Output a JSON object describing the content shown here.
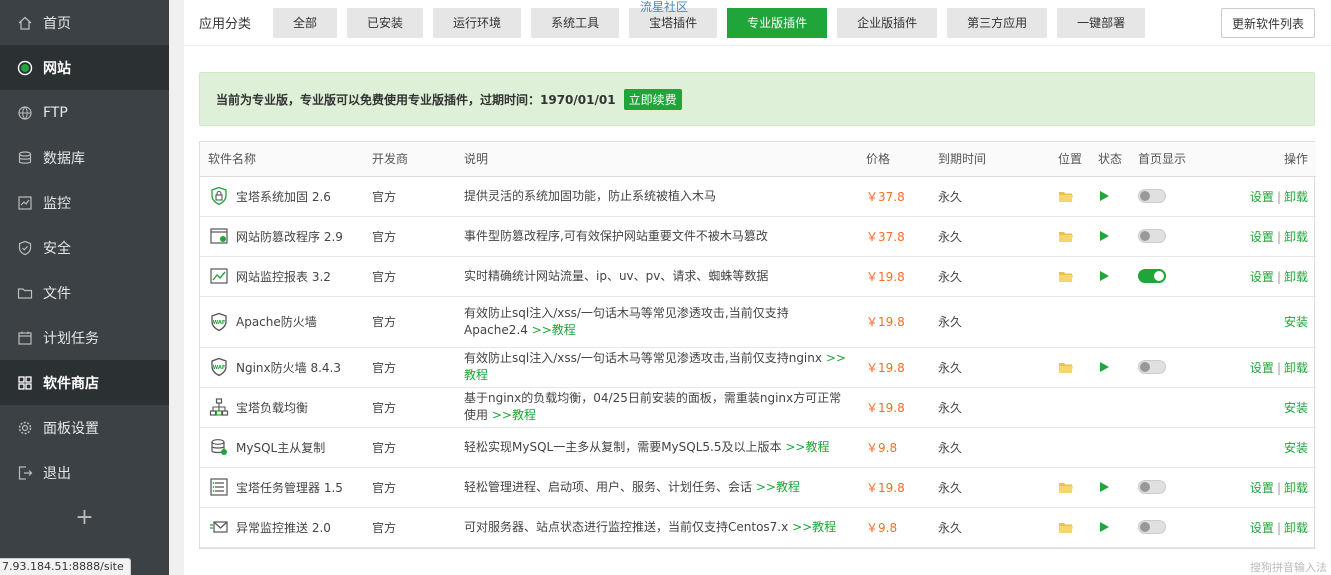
{
  "sidebar": {
    "items": [
      {
        "label": "首页",
        "icon": "home-icon",
        "active": false
      },
      {
        "label": "网站",
        "icon": "globe-icon",
        "active": true
      },
      {
        "label": "FTP",
        "icon": "ftp-icon",
        "active": false
      },
      {
        "label": "数据库",
        "icon": "database-icon",
        "active": false
      },
      {
        "label": "监控",
        "icon": "monitor-icon",
        "active": false
      },
      {
        "label": "安全",
        "icon": "shield-icon",
        "active": false
      },
      {
        "label": "文件",
        "icon": "folder-icon",
        "active": false
      },
      {
        "label": "计划任务",
        "icon": "calendar-icon",
        "active": false
      },
      {
        "label": "软件商店",
        "icon": "grid-icon",
        "active": true
      },
      {
        "label": "面板设置",
        "icon": "gear-icon",
        "active": false
      },
      {
        "label": "退出",
        "icon": "logout-icon",
        "active": false
      }
    ],
    "add_label": "+"
  },
  "status_url": "7.93.184.51:8888/site",
  "watermark": "流星社区",
  "categories": {
    "label": "应用分类",
    "items": [
      "全部",
      "已安装",
      "运行环境",
      "系统工具",
      "宝塔插件",
      "专业版插件",
      "企业版插件",
      "第三方应用",
      "一键部署"
    ],
    "active_index": 5,
    "refresh_label": "更新软件列表"
  },
  "notice": {
    "text": "当前为专业版，专业版可以免费使用专业版插件，过期时间：1970/01/01",
    "renew_label": "立即续费"
  },
  "table": {
    "headers": [
      "软件名称",
      "开发商",
      "说明",
      "价格",
      "到期时间",
      "位置",
      "状态",
      "首页显示",
      "操作"
    ],
    "rows": [
      {
        "name": "宝塔系统加固 2.6",
        "icon": "lock-shield-icon",
        "dev": "官方",
        "desc": "提供灵活的系统加固功能，防止系统被植入木马",
        "tutorial": "",
        "price": "￥37.8",
        "expire": "永久",
        "installed": true,
        "home_on": false,
        "ops": [
          "设置",
          "卸载"
        ]
      },
      {
        "name": "网站防篡改程序 2.9",
        "icon": "browser-lock-icon",
        "dev": "官方",
        "desc": "事件型防篡改程序,可有效保护网站重要文件不被木马篡改",
        "tutorial": "",
        "price": "￥37.8",
        "expire": "永久",
        "installed": true,
        "home_on": false,
        "ops": [
          "设置",
          "卸载"
        ]
      },
      {
        "name": "网站监控报表 3.2",
        "icon": "chart-icon",
        "dev": "官方",
        "desc": "实时精确统计网站流量、ip、uv、pv、请求、蜘蛛等数据",
        "tutorial": "",
        "price": "￥19.8",
        "expire": "永久",
        "installed": true,
        "home_on": true,
        "ops": [
          "设置",
          "卸载"
        ]
      },
      {
        "name": "Apache防火墙",
        "icon": "waf-icon",
        "dev": "官方",
        "desc": "有效防止sql注入/xss/一句话木马等常见渗透攻击,当前仅支持Apache2.4",
        "tutorial": ">>教程",
        "price": "￥19.8",
        "expire": "永久",
        "installed": false,
        "home_on": false,
        "ops": [
          "安装"
        ]
      },
      {
        "name": "Nginx防火墙 8.4.3",
        "icon": "waf-icon",
        "dev": "官方",
        "desc": "有效防止sql注入/xss/一句话木马等常见渗透攻击,当前仅支持nginx",
        "tutorial": ">>教程",
        "price": "￥19.8",
        "expire": "永久",
        "installed": true,
        "home_on": false,
        "ops": [
          "设置",
          "卸载"
        ]
      },
      {
        "name": "宝塔负载均衡",
        "icon": "network-icon",
        "dev": "官方",
        "desc": "基于nginx的负载均衡，04/25日前安装的面板，需重装nginx方可正常使用",
        "tutorial": ">>教程",
        "price": "￥19.8",
        "expire": "永久",
        "installed": false,
        "home_on": false,
        "ops": [
          "安装"
        ]
      },
      {
        "name": "MySQL主从复制",
        "icon": "db-sync-icon",
        "dev": "官方",
        "desc": "轻松实现MySQL一主多从复制，需要MySQL5.5及以上版本",
        "tutorial": ">>教程",
        "price": "￥9.8",
        "expire": "永久",
        "installed": false,
        "home_on": false,
        "ops": [
          "安装"
        ]
      },
      {
        "name": "宝塔任务管理器 1.5",
        "icon": "task-list-icon",
        "dev": "官方",
        "desc": "轻松管理进程、启动项、用户、服务、计划任务、会话",
        "tutorial": ">>教程",
        "price": "￥19.8",
        "expire": "永久",
        "installed": true,
        "home_on": false,
        "ops": [
          "设置",
          "卸载"
        ]
      },
      {
        "name": "异常监控推送 2.0",
        "icon": "mail-push-icon",
        "dev": "官方",
        "desc": "可对服务器、站点状态进行监控推送，当前仅支持Centos7.x",
        "tutorial": ">>教程",
        "price": "￥9.8",
        "expire": "永久",
        "installed": true,
        "home_on": false,
        "ops": [
          "设置",
          "卸载"
        ]
      }
    ]
  },
  "ime_label": "搜狗拼音输入法",
  "colors": {
    "accent": "#20a53a",
    "price": "#fc6d26",
    "sidebar": "#3b4145"
  }
}
